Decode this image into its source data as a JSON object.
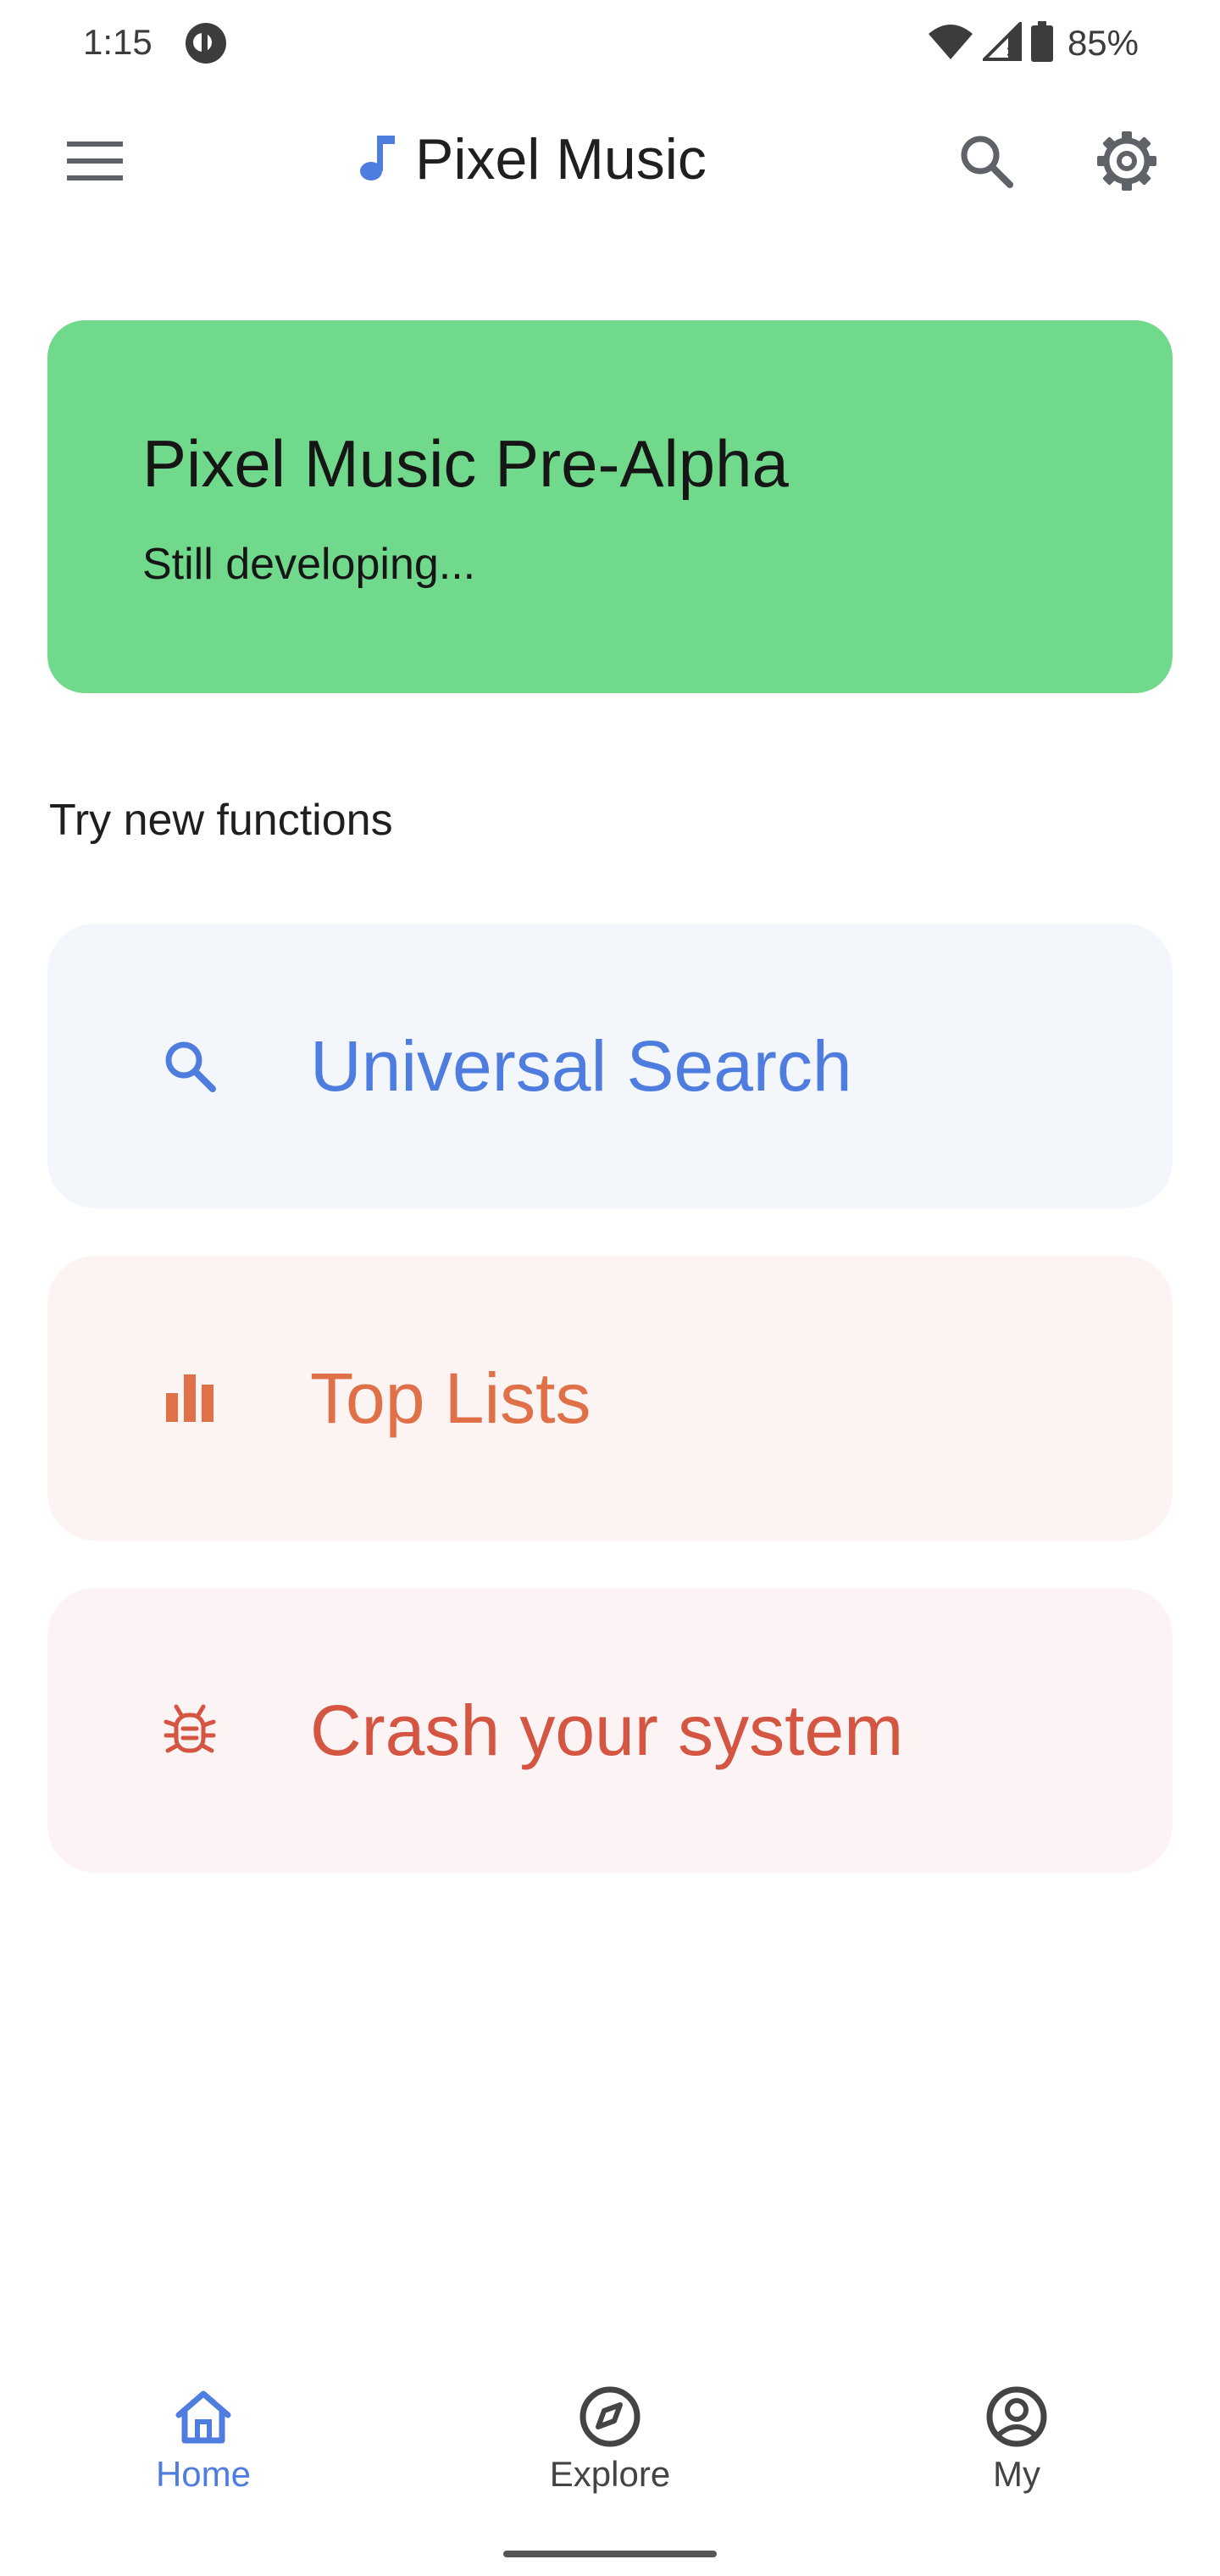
{
  "status_bar": {
    "time": "1:15",
    "battery_text": "85%",
    "icons": [
      "privacy-indicator-icon",
      "wifi-icon",
      "cell-signal-icon",
      "battery-icon"
    ]
  },
  "app_bar": {
    "title": "Pixel Music",
    "icons": [
      "menu-icon",
      "music-note-icon",
      "search-icon",
      "settings-icon"
    ]
  },
  "banner": {
    "title": "Pixel Music Pre-Alpha",
    "subtitle": "Still developing...",
    "color": "#71d98b"
  },
  "section": {
    "label": "Try new functions"
  },
  "functions": [
    {
      "label": "Universal Search",
      "icon": "search-icon",
      "color": "#4e7ddf",
      "background": "#f3f6fb"
    },
    {
      "label": "Top Lists",
      "icon": "bar-chart-icon",
      "color": "#e07047",
      "background": "#fbf4f3"
    },
    {
      "label": "Crash your system",
      "icon": "bug-icon",
      "color": "#d45541",
      "background": "#fbf3f4"
    }
  ],
  "bottom_nav": {
    "selected": "Home",
    "items": [
      {
        "label": "Home",
        "icon": "home-icon"
      },
      {
        "label": "Explore",
        "icon": "compass-icon"
      },
      {
        "label": "My",
        "icon": "account-circle-icon"
      }
    ],
    "accent": "#4e7ddf"
  }
}
